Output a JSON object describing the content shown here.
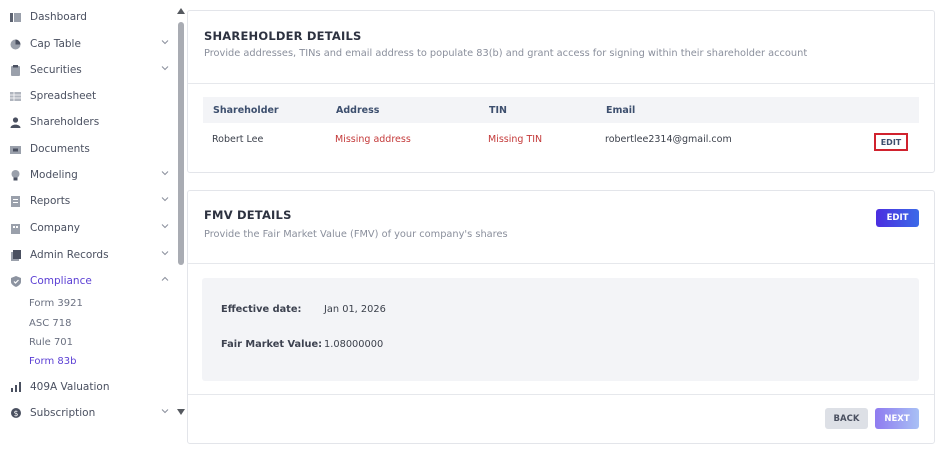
{
  "sidebar": {
    "items": [
      {
        "label": "Dashboard",
        "icon": "dashboard-icon",
        "has_chevron": false
      },
      {
        "label": "Cap Table",
        "icon": "pie-chart-icon",
        "has_chevron": true
      },
      {
        "label": "Securities",
        "icon": "clipboard-icon",
        "has_chevron": true
      },
      {
        "label": "Spreadsheet",
        "icon": "spreadsheet-icon",
        "has_chevron": false
      },
      {
        "label": "Shareholders",
        "icon": "person-icon",
        "has_chevron": false
      },
      {
        "label": "Documents",
        "icon": "folder-icon",
        "has_chevron": false
      },
      {
        "label": "Modeling",
        "icon": "lightbulb-icon",
        "has_chevron": true
      },
      {
        "label": "Reports",
        "icon": "report-icon",
        "has_chevron": true
      },
      {
        "label": "Company",
        "icon": "building-icon",
        "has_chevron": true
      },
      {
        "label": "Admin Records",
        "icon": "records-icon",
        "has_chevron": true
      },
      {
        "label": "Compliance",
        "icon": "shield-icon",
        "has_chevron": true,
        "active": true
      }
    ],
    "compliance_subitems": [
      {
        "label": "Form 3921"
      },
      {
        "label": "ASC 718"
      },
      {
        "label": "Rule 701"
      },
      {
        "label": "Form 83b",
        "active": true
      }
    ],
    "bottom_items": [
      {
        "label": "409A Valuation",
        "icon": "chart-icon",
        "has_chevron": false
      },
      {
        "label": "Subscription",
        "icon": "dollar-icon",
        "has_chevron": true
      }
    ]
  },
  "shareholder_card": {
    "title": "SHAREHOLDER DETAILS",
    "subtitle": "Provide addresses, TINs and email address to populate 83(b) and grant access for signing within their shareholder account",
    "columns": [
      "Shareholder",
      "Address",
      "TIN",
      "Email"
    ],
    "row": {
      "shareholder": "Robert Lee",
      "address": "Missing address",
      "tin": "Missing TIN",
      "email": "robertlee2314@gmail.com",
      "edit_label": "EDIT"
    }
  },
  "fmv_card": {
    "title": "FMV DETAILS",
    "subtitle": "Provide the Fair Market Value (FMV) of your company's shares",
    "edit_label": "EDIT",
    "effective_date_label": "Effective date:",
    "effective_date_value": "Jan 01, 2026",
    "fmv_label": "Fair Market Value:",
    "fmv_value": "1.08000000",
    "back_label": "BACK",
    "next_label": "NEXT"
  },
  "colors": {
    "accent": "#5b3fd4",
    "missing": "#c43a3a",
    "highlight_border": "#d0222e"
  }
}
